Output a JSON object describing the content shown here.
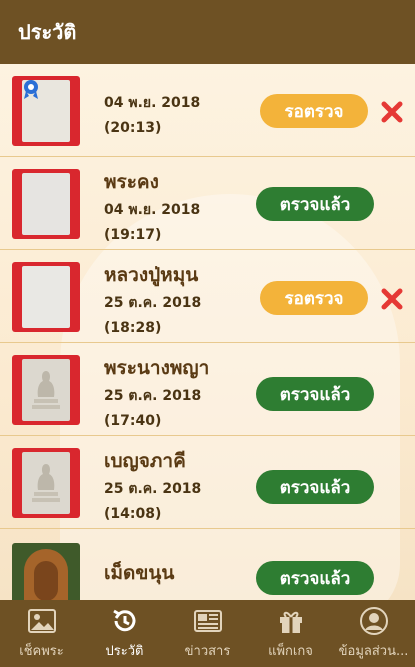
{
  "header": {
    "title": "ประวัติ"
  },
  "items": [
    {
      "title": "",
      "date": "04 พ.ย. 2018",
      "time": "(20:13)",
      "status": "รอตรวจ",
      "state": "pending",
      "deletable": true
    },
    {
      "title": "พระคง",
      "date": "04 พ.ย. 2018",
      "time": "(19:17)",
      "status": "ตรวจแล้ว",
      "state": "done",
      "deletable": false
    },
    {
      "title": "หลวงปู่หมุน",
      "date": "25 ต.ค. 2018",
      "time": "(18:28)",
      "status": "รอตรวจ",
      "state": "pending",
      "deletable": true
    },
    {
      "title": "พระนางพญา",
      "date": "25 ต.ค. 2018",
      "time": "(17:40)",
      "status": "ตรวจแล้ว",
      "state": "done",
      "deletable": false
    },
    {
      "title": "เบญจภาคี",
      "date": "25 ต.ค. 2018",
      "time": "(14:08)",
      "status": "ตรวจแล้ว",
      "state": "done",
      "deletable": false
    },
    {
      "title": "เม็ดขนุน",
      "date": "",
      "time": "",
      "status": "ตรวจแล้ว",
      "state": "done",
      "deletable": false
    }
  ],
  "tabs": [
    {
      "label": "เช็คพระ",
      "icon": "image-icon",
      "active": false
    },
    {
      "label": "ประวัติ",
      "icon": "history-icon",
      "active": true
    },
    {
      "label": "ข่าวสาร",
      "icon": "newspaper-icon",
      "active": false
    },
    {
      "label": "แพ็กเกจ",
      "icon": "gift-icon",
      "active": false
    },
    {
      "label": "ข้อมูลส่วน...",
      "icon": "user-icon",
      "active": false
    }
  ],
  "colors": {
    "header_bg": "#6e5124",
    "pending": "#f3b33a",
    "done": "#2e7d32",
    "delete": "#e53935",
    "background": "#fdf3e1"
  }
}
